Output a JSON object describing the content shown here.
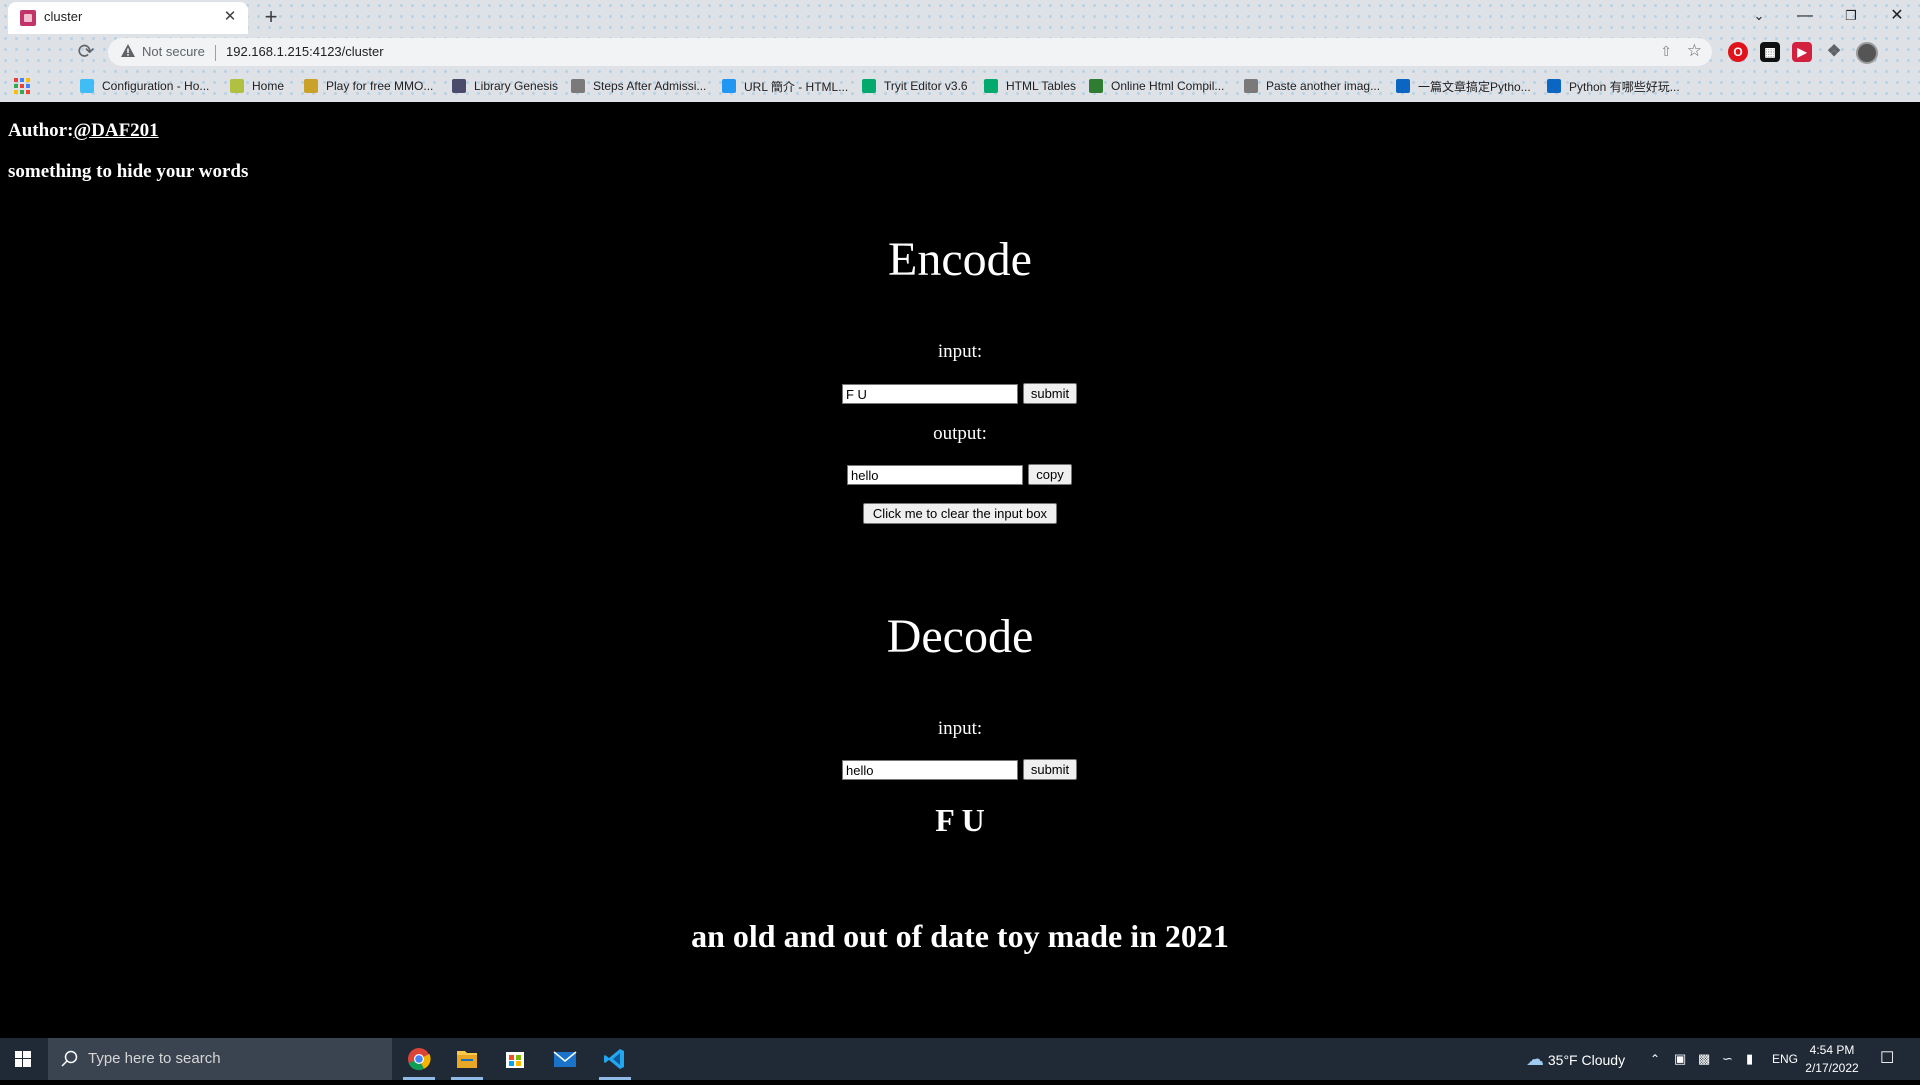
{
  "browser": {
    "tab_title": "cluster",
    "security_label": "Not secure",
    "url": "192.168.1.215:4123/cluster",
    "bookmarks": [
      {
        "label": "Configuration - Ho...",
        "icon": "home-assistant-icon",
        "color": "#41bdf5"
      },
      {
        "label": "Home",
        "icon": "home-icon",
        "color": "#b0c040"
      },
      {
        "label": "Play for free MMO...",
        "icon": "game-icon",
        "color": "#c9a227"
      },
      {
        "label": "Library Genesis",
        "icon": "book-icon",
        "color": "#4a4a6a"
      },
      {
        "label": "Steps After Admissi...",
        "icon": "globe-icon",
        "color": "#7a7a7a"
      },
      {
        "label": "URL 簡介 - HTML...",
        "icon": "w3-icon",
        "color": "#2196f3"
      },
      {
        "label": "Tryit Editor v3.6",
        "icon": "w3schools-icon",
        "color": "#04aa6d"
      },
      {
        "label": "HTML Tables",
        "icon": "w3schools-icon",
        "color": "#04aa6d"
      },
      {
        "label": "Online Html Compil...",
        "icon": "code-icon",
        "color": "#2e7d32"
      },
      {
        "label": "Paste another imag...",
        "icon": "globe-icon",
        "color": "#7a7a7a"
      },
      {
        "label": "一篇文章搞定Pytho...",
        "icon": "zhihu-icon",
        "color": "#0a66c2"
      },
      {
        "label": "Python 有哪些好玩...",
        "icon": "zhihu-icon",
        "color": "#0a66c2"
      }
    ]
  },
  "page": {
    "author_prefix": "Author:",
    "author_handle": "@DAF201",
    "tagline": "something to hide your words",
    "encode": {
      "heading": "Encode",
      "input_label": "input:",
      "input_value": "F U",
      "submit_label": "submit",
      "output_label": "output:",
      "output_value": "hello",
      "copy_label": "copy",
      "clear_label": "Click me to clear the input box"
    },
    "decode": {
      "heading": "Decode",
      "input_label": "input:",
      "input_value": "hello",
      "submit_label": "submit",
      "result": "F U"
    },
    "footer": "an old and out of date toy made in 2021"
  },
  "taskbar": {
    "search_placeholder": "Type here to search",
    "weather": "35°F  Cloudy",
    "language": "ENG",
    "time": "4:54 PM",
    "date": "2/17/2022"
  }
}
